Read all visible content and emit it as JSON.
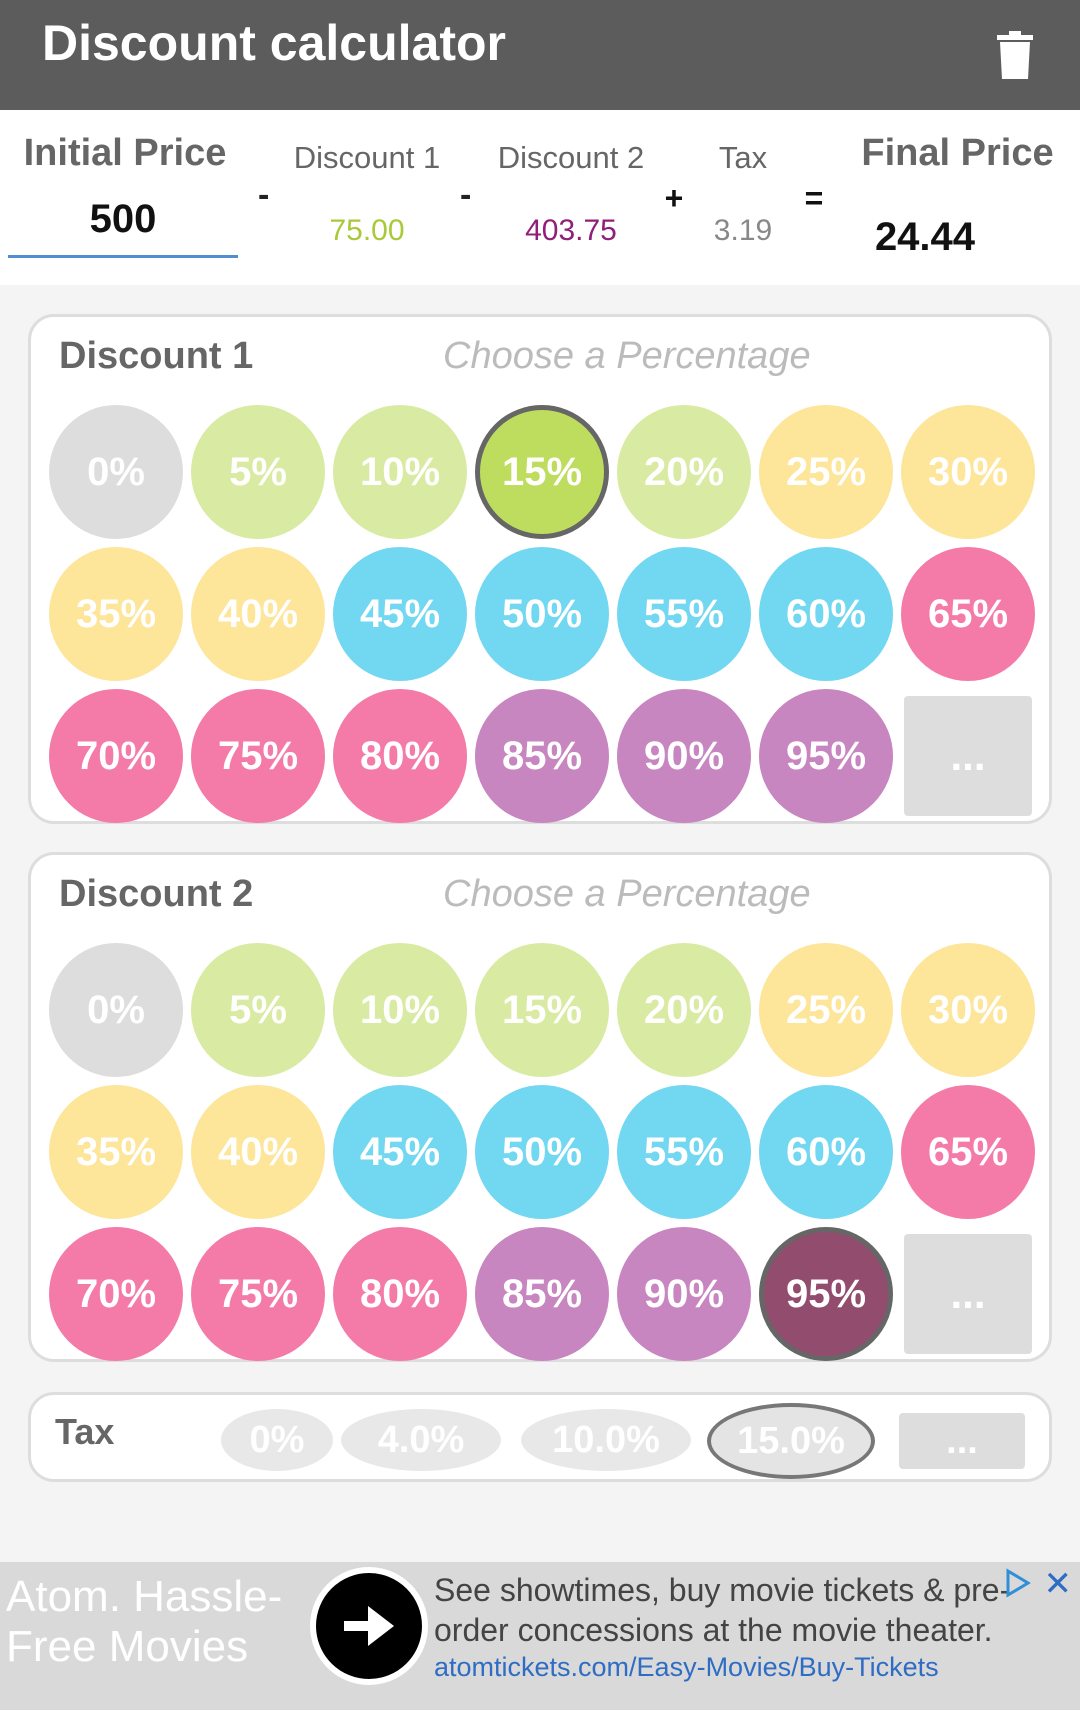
{
  "app": {
    "title": "Discount calculator",
    "clear_icon": "trash-icon"
  },
  "summary": {
    "initial_label": "Initial Price",
    "initial_value": "500",
    "minus1": "-",
    "minus2": "-",
    "plus": "+",
    "equals": "=",
    "d1_label": "Discount 1",
    "d1_value": "75.00",
    "d2_label": "Discount 2",
    "d2_value": "403.75",
    "tax_label": "Tax",
    "tax_value": "3.19",
    "final_label": "Final Price",
    "final_value": "24.44"
  },
  "discount1": {
    "title": "Discount 1",
    "hint": "Choose a Percentage",
    "selected": "15%",
    "options": [
      "0%",
      "5%",
      "10%",
      "15%",
      "20%",
      "25%",
      "30%",
      "35%",
      "40%",
      "45%",
      "50%",
      "55%",
      "60%",
      "65%",
      "70%",
      "75%",
      "80%",
      "85%",
      "90%",
      "95%",
      "..."
    ]
  },
  "discount2": {
    "title": "Discount 2",
    "hint": "Choose a Percentage",
    "selected": "95%",
    "options": [
      "0%",
      "5%",
      "10%",
      "15%",
      "20%",
      "25%",
      "30%",
      "35%",
      "40%",
      "45%",
      "50%",
      "55%",
      "60%",
      "65%",
      "70%",
      "75%",
      "80%",
      "85%",
      "90%",
      "95%",
      "..."
    ]
  },
  "tax": {
    "title": "Tax",
    "options": [
      "0%",
      "4.0%",
      "10.0%",
      "15.0%",
      "..."
    ],
    "selected": "15.0%"
  },
  "colors": {
    "grey": "#dddddd",
    "lightgreen": "#d9eaa3",
    "green_selected": "#bedd5e",
    "yellow": "#fde59a",
    "blue": "#72d7f0",
    "pink": "#f47ba8",
    "purple": "#c886c0",
    "purple_selected": "#924c6e",
    "d1_value": "#a9c93b",
    "d2_value": "#8e1f7a",
    "tax_value": "#888888"
  },
  "ad": {
    "headline": "Atom. Hassle-Free Movies",
    "description": "See showtimes, buy movie tickets & pre-order concessions at the movie theater.",
    "url": "atomtickets.com/Easy-Movies/Buy-Tickets"
  }
}
